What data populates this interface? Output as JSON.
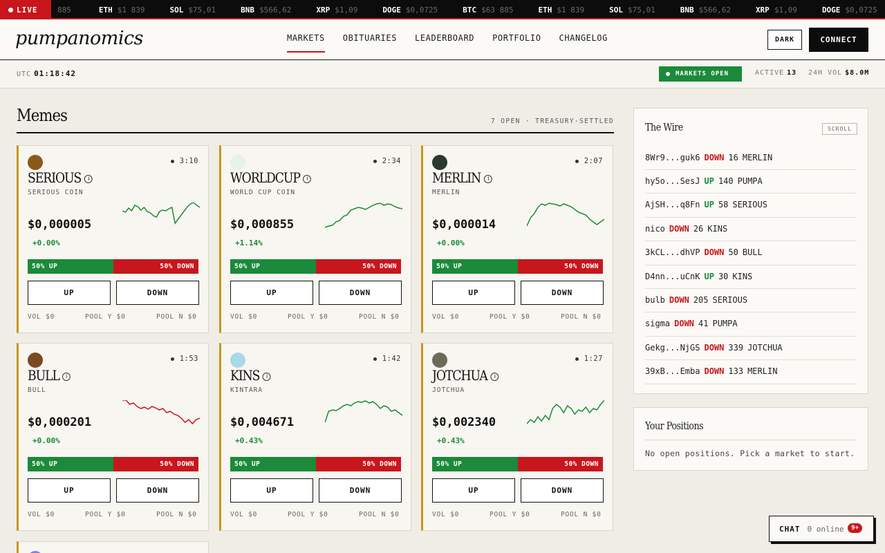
{
  "ticker": {
    "live_label": "LIVE",
    "items": [
      {
        "sym": "",
        "px": "885"
      },
      {
        "sym": "ETH",
        "px": "$1 839"
      },
      {
        "sym": "SOL",
        "px": "$75,01"
      },
      {
        "sym": "BNB",
        "px": "$566,62"
      },
      {
        "sym": "XRP",
        "px": "$1,09"
      },
      {
        "sym": "DOGE",
        "px": "$0,0725"
      },
      {
        "sym": "BTC",
        "px": "$63 885"
      },
      {
        "sym": "ETH",
        "px": "$1 839"
      },
      {
        "sym": "SOL",
        "px": "$75,01"
      },
      {
        "sym": "BNB",
        "px": "$566,62"
      },
      {
        "sym": "XRP",
        "px": "$1,09"
      },
      {
        "sym": "DOGE",
        "px": "$0,0725"
      }
    ]
  },
  "header": {
    "logo": "pumpanomics",
    "nav": [
      "MARKETS",
      "OBITUARIES",
      "LEADERBOARD",
      "PORTFOLIO",
      "CHANGELOG"
    ],
    "dark_label": "DARK",
    "connect_label": "CONNECT"
  },
  "status": {
    "utc_label": "UTC",
    "utc_time": "01:18:42",
    "markets_open": "MARKETS OPEN",
    "active_label": "ACTIVE",
    "active_value": "13",
    "vol_label": "24H VOL",
    "vol_value": "$8.0M"
  },
  "memes": {
    "title": "Memes",
    "meta": "7 OPEN · TREASURY-SETTLED",
    "up_label": "UP",
    "down_label": "DOWN",
    "cards": [
      {
        "name": "SERIOUS",
        "sub": "SERIOUS COIN",
        "timer": "3:10",
        "price": "$0,000005",
        "change": "+0.00%",
        "up_pct": "50% UP",
        "down_pct": "50% DOWN",
        "vol": "VOL $0",
        "pool_y": "POOL Y $0",
        "pool_n": "POOL N $0",
        "trend": "up",
        "spark": [
          30,
          28,
          34,
          30,
          38,
          36,
          31,
          35,
          29,
          27,
          23,
          21,
          29,
          31,
          30,
          33,
          35,
          12,
          18,
          24,
          30,
          36,
          40,
          42,
          38,
          35
        ],
        "avatar_color": "#8a5a1a"
      },
      {
        "name": "WORLDCUP",
        "sub": "WORLD CUP COIN",
        "timer": "2:34",
        "price": "$0,000855",
        "change": "+1.14%",
        "up_pct": "50% UP",
        "down_pct": "50% DOWN",
        "vol": "VOL $0",
        "pool_y": "POOL Y $0",
        "pool_n": "POOL N $0",
        "trend": "up",
        "spark": [
          6,
          8,
          9,
          14,
          16,
          22,
          24,
          31,
          33,
          35,
          34,
          32,
          35,
          38,
          40,
          41,
          38,
          40,
          39,
          36,
          34,
          33
        ],
        "avatar_color": "#e6f2ea"
      },
      {
        "name": "MERLIN",
        "sub": "MERLIN",
        "timer": "2:07",
        "price": "$0,000014",
        "change": "+0.00%",
        "up_pct": "50% UP",
        "down_pct": "50% DOWN",
        "vol": "VOL $0",
        "pool_y": "POOL Y $0",
        "pool_n": "POOL N $0",
        "trend": "up",
        "spark": [
          8,
          20,
          26,
          35,
          40,
          38,
          41,
          40,
          39,
          37,
          40,
          38,
          36,
          32,
          28,
          26,
          24,
          18,
          14,
          10,
          14,
          18
        ],
        "avatar_color": "#2c3a2e"
      },
      {
        "name": "BULL",
        "sub": "BULL",
        "timer": "1:53",
        "price": "$0,000201",
        "change": "+0.00%",
        "up_pct": "50% UP",
        "down_pct": "50% DOWN",
        "vol": "VOL $0",
        "pool_y": "POOL Y $0",
        "pool_n": "POOL N $0",
        "trend": "down",
        "spark": [
          42,
          42,
          36,
          38,
          33,
          30,
          32,
          29,
          33,
          31,
          28,
          30,
          24,
          26,
          22,
          20,
          16,
          10,
          14,
          8,
          14,
          16
        ],
        "avatar_color": "#7a4a22"
      },
      {
        "name": "KINS",
        "sub": "KINTARA",
        "timer": "1:42",
        "price": "$0,004671",
        "change": "+0.43%",
        "up_pct": "50% UP",
        "down_pct": "50% DOWN",
        "vol": "VOL $0",
        "pool_y": "POOL Y $0",
        "pool_n": "POOL N $0",
        "trend": "up",
        "spark": [
          10,
          26,
          28,
          27,
          30,
          34,
          36,
          34,
          38,
          40,
          39,
          41,
          38,
          40,
          36,
          30,
          34,
          32,
          26,
          28,
          24,
          20
        ],
        "avatar_color": "#a9d8e8"
      },
      {
        "name": "JOTCHUA",
        "sub": "JOTCHUA",
        "timer": "1:27",
        "price": "$0,002340",
        "change": "+0.43%",
        "up_pct": "50% UP",
        "down_pct": "50% DOWN",
        "vol": "VOL $0",
        "pool_y": "POOL Y $0",
        "pool_n": "POOL N $0",
        "trend": "up",
        "spark": [
          8,
          14,
          10,
          18,
          12,
          20,
          14,
          30,
          36,
          32,
          24,
          34,
          30,
          22,
          28,
          26,
          32,
          24,
          30,
          28,
          36,
          42
        ],
        "avatar_color": "#6b6b5a"
      }
    ]
  },
  "wire": {
    "title": "The Wire",
    "scroll_label": "SCROLL",
    "rows": [
      {
        "who": "8Wr9...guk6",
        "dir": "DOWN",
        "amt": "16",
        "coin": "MERLIN"
      },
      {
        "who": "hy5o...SesJ",
        "dir": "UP",
        "amt": "140",
        "coin": "PUMPA"
      },
      {
        "who": "AjSH...q8Fn",
        "dir": "UP",
        "amt": "58",
        "coin": "SERIOUS"
      },
      {
        "who": "nico",
        "dir": "DOWN",
        "amt": "26",
        "coin": "KINS"
      },
      {
        "who": "3kCL...dhVP",
        "dir": "DOWN",
        "amt": "50",
        "coin": "BULL"
      },
      {
        "who": "D4nn...uCnK",
        "dir": "UP",
        "amt": "30",
        "coin": "KINS"
      },
      {
        "who": "bulb",
        "dir": "DOWN",
        "amt": "205",
        "coin": "SERIOUS"
      },
      {
        "who": "sigma",
        "dir": "DOWN",
        "amt": "41",
        "coin": "PUMPA"
      },
      {
        "who": "Gekg...NjGS",
        "dir": "DOWN",
        "amt": "339",
        "coin": "JOTCHUA"
      },
      {
        "who": "39xB...Emba",
        "dir": "DOWN",
        "amt": "133",
        "coin": "MERLIN"
      }
    ]
  },
  "positions": {
    "title": "Your Positions",
    "empty": "No open positions. Pick a market to start."
  },
  "chat": {
    "label": "CHAT",
    "online": "0 online",
    "badge": "9+"
  },
  "colors": {
    "up": "#1b8a3a",
    "down": "#c8161d",
    "card_accent": "#c8961a"
  }
}
